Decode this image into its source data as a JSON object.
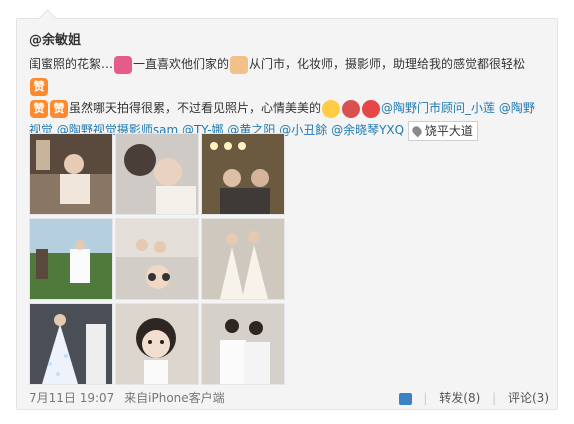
{
  "author": {
    "name": "@余敏姐"
  },
  "post": {
    "text_1": "闺蜜照的花絮…",
    "text_2": "一直喜欢他们家的",
    "text_3": "从门市，化妆师，摄影师，助理给我的感觉都很轻松",
    "text_4": "虽然哪天拍得很累，不过看见照片，心情美美的",
    "zan_label": "赞",
    "mentions": [
      "@陶野门市顾问_小莲",
      "@陶野视觉",
      "@陶野视觉摄影师sam",
      "@TY-娜",
      "@黄之阳",
      "@小丑餘",
      "@余晓琴YXQ"
    ],
    "location": "饶平大道"
  },
  "footer": {
    "timestamp": "7月11日 19:07",
    "source": "来自iPhone客户端",
    "repost": "转发(8)",
    "comment": "评论(3)"
  },
  "icons": [
    "bow-emoji-icon",
    "clap-emoji-icon",
    "zan-emoji-icon",
    "laugh-emoji-icon",
    "cake-emoji-icon",
    "blush-emoji-icon",
    "location-pin-icon",
    "thumbs-up-icon"
  ]
}
